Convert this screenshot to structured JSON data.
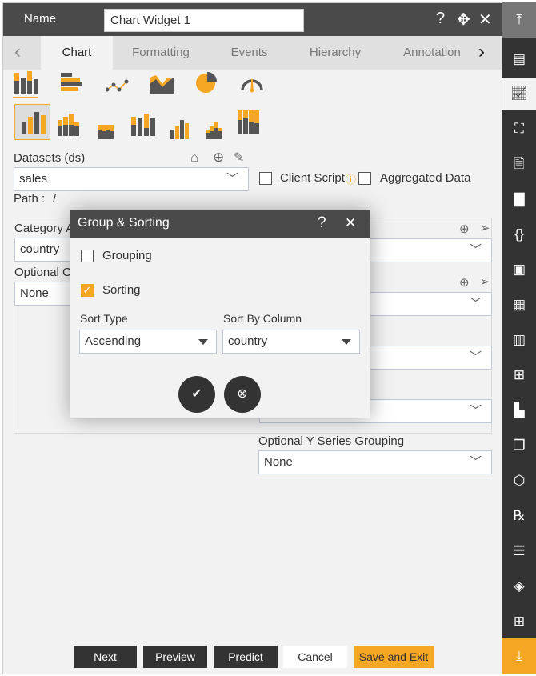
{
  "header": {
    "name_label": "Name",
    "name_value": "Chart Widget 1",
    "help": "?",
    "move": "✥",
    "close": "✕"
  },
  "tabs": [
    {
      "label": "Chart"
    },
    {
      "label": "Formatting"
    },
    {
      "label": "Events"
    },
    {
      "label": "Hierarchy"
    },
    {
      "label": "Annotation"
    }
  ],
  "chart_types": [
    "column",
    "bar",
    "line",
    "area",
    "pie",
    "gauge"
  ],
  "subtypes": [
    "clustered",
    "stacked",
    "stacked-small",
    "stacked-tall",
    "clustered-small",
    "stacked-grouped",
    "100-percent"
  ],
  "datasets": {
    "label": "Datasets (ds)",
    "value": "sales",
    "path_label": "Path :",
    "path_value": "/"
  },
  "options": {
    "client_script": "Client Script",
    "aggregated": "Aggregated Data"
  },
  "category": {
    "label": "Category A",
    "value": "country"
  },
  "optional_c": {
    "label": "Optional C",
    "value": "None"
  },
  "y_grouping": {
    "label": "Optional Y Series Grouping",
    "value": "None"
  },
  "dialog": {
    "title": "Group & Sorting",
    "help": "?",
    "close": "✕",
    "grouping": "Grouping",
    "grouping_checked": false,
    "sorting": "Sorting",
    "sorting_checked": true,
    "sort_type_label": "Sort Type",
    "sort_type": "Ascending",
    "sort_by_label": "Sort By Column",
    "sort_by": "country"
  },
  "footer": {
    "next": "Next",
    "preview": "Preview",
    "predict": "Predict",
    "cancel": "Cancel",
    "save": "Save and Exit"
  },
  "colors": {
    "accent": "#f5a623",
    "dark": "#4a4a4a"
  },
  "sidebar": [
    "scroll-top",
    "table",
    "chart",
    "map",
    "document-chart",
    "document",
    "code",
    "image",
    "calendar",
    "report",
    "hierarchy",
    "bar-chart",
    "copy",
    "cubes",
    "rx",
    "notes",
    "layers",
    "add-widget",
    "scroll-bottom"
  ]
}
